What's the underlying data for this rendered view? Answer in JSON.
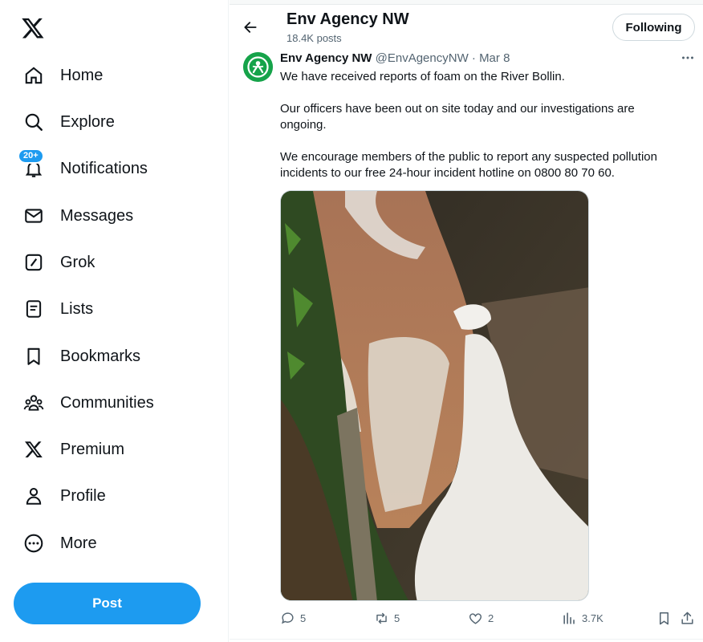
{
  "nav": {
    "items": [
      {
        "label": "Home",
        "icon": "home-icon"
      },
      {
        "label": "Explore",
        "icon": "search-icon"
      },
      {
        "label": "Notifications",
        "icon": "bell-icon",
        "badge": "20+"
      },
      {
        "label": "Messages",
        "icon": "envelope-icon"
      },
      {
        "label": "Grok",
        "icon": "grok-icon"
      },
      {
        "label": "Lists",
        "icon": "list-icon"
      },
      {
        "label": "Bookmarks",
        "icon": "bookmark-icon"
      },
      {
        "label": "Communities",
        "icon": "people-icon"
      },
      {
        "label": "Premium",
        "icon": "x-logo-icon"
      },
      {
        "label": "Profile",
        "icon": "person-icon"
      },
      {
        "label": "More",
        "icon": "more-circle-icon"
      }
    ],
    "post_label": "Post"
  },
  "header": {
    "name": "Env Agency NW",
    "post_count": "18.4K posts",
    "following_label": "Following"
  },
  "tweet": {
    "display_name": "Env Agency NW",
    "meta": "@EnvAgencyNW · Mar 8",
    "paragraphs": [
      "We have received reports of foam on the River Bollin.",
      "Our officers have been out on site today and our investigations are ongoing.",
      "We encourage members of the public to report any suspected pollution incidents to our free 24-hour incident hotline on 0800 80 70 60."
    ],
    "replies": "5",
    "reposts": "5",
    "likes": "2",
    "views": "3.7K"
  },
  "colors": {
    "accent": "#1d9bf0",
    "text": "#0f1419",
    "muted": "#536471",
    "avatar": "#16a34a"
  }
}
